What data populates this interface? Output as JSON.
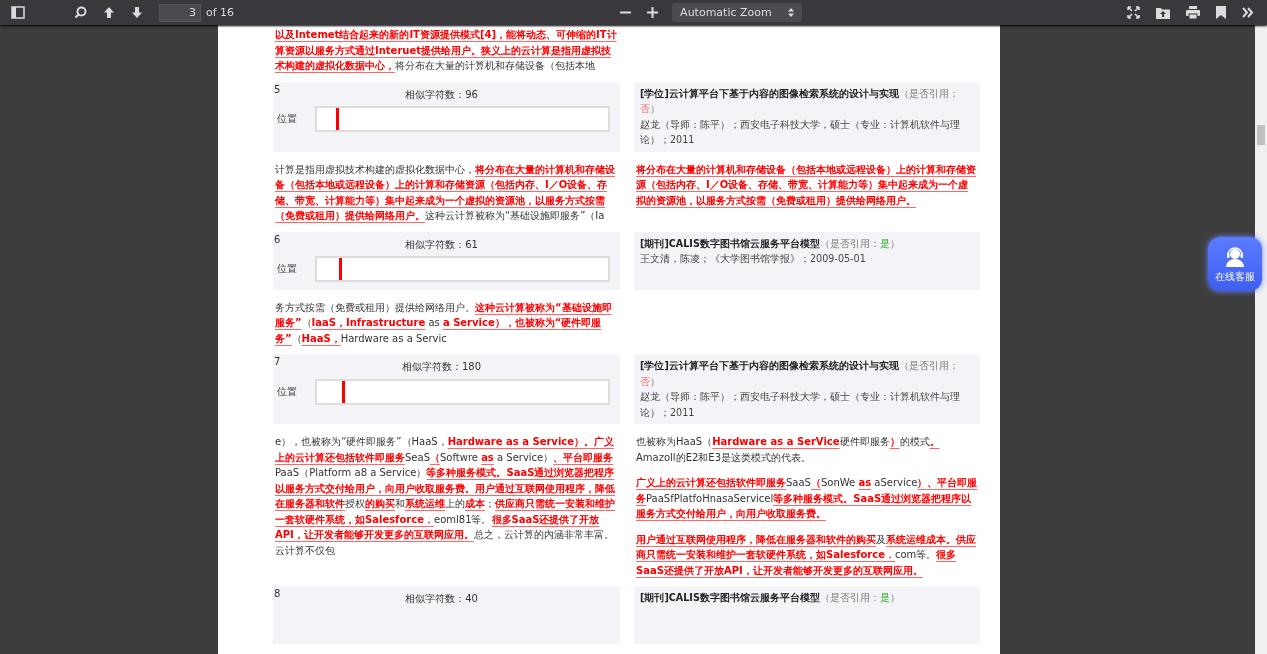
{
  "toolbar": {
    "page": "3",
    "page_count": "of 16",
    "zoom": "Automatic Zoom"
  },
  "document": {
    "blocks": [
      {
        "kind": "text",
        "left": [
          [
            {
              "text": "以及Intemet结合起来的新的IT资源提供模式[4]，能将动态、可伸缩的IT计算资源以服务方式通过Interuet提供给用户。狭义上的云计算是指用虚拟技术构建的虚拟化数据中心，",
              "hit": true
            },
            {
              "text": "将分布在大量的计算机和存储设备（包括本地",
              "hit": false
            }
          ]
        ]
      },
      {
        "kind": "match",
        "number": "5",
        "similar": "相似字符数：96",
        "position_label": "位置",
        "level": 0.065,
        "source": {
          "title": "[学位]云计算平台下基于内容的图像检索系统的设计与实现",
          "cite_prefix": "（是否引用：",
          "cite_value": "否",
          "cite_suffix": "）",
          "cited": false,
          "details": "赵龙（导师：陈平）；西安电子科技大学，硕士（专业：计算机软件与理论）；2011"
        }
      },
      {
        "kind": "text",
        "left": [
          [
            {
              "text": "计算是指用虚拟技术构建的虚拟化数据中心，",
              "hit": false
            },
            {
              "text": "将分布在大量的计算机和存储设备（包括本地或远程设备）上的计算和存储资源（包括内存、I／O设备、存储、带宽、计算能力等）集中起来成为一个虚拟的资源池，以服务方式按需（免费或租用）提供给网络用户。",
              "hit": true
            },
            {
              "text": "这种云计算被称为“基础设施即服务”（Ia",
              "hit": false
            }
          ]
        ],
        "right": [
          [
            {
              "text": "将分布在大量的计算机和存储设备（包括本地或远程设备）上的计算和存储资源（包括内存、I／O设备、存储、带宽、计算能力等）集中起来成为一个虚拟的资源池，以服务方式按需（免费或租用）提供给网络用户。",
              "hit": true
            }
          ]
        ]
      },
      {
        "kind": "match",
        "number": "6",
        "similar": "相似字符数：61",
        "position_label": "位置",
        "level": 0.075,
        "source": {
          "title": "[期刊]CALIS数字图书馆云服务平台模型",
          "cite_prefix": "（是否引用：",
          "cite_value": "是",
          "cite_suffix": "）",
          "cited": true,
          "details": "王文清，陈凌；《大学图书馆学报》；2009-05-01"
        }
      },
      {
        "kind": "text",
        "left": [
          [
            {
              "text": "务方式按需（免费或租用）提供给网络用户。",
              "hit": false
            },
            {
              "text": "这种云计算被称为“基础设施即服务”",
              "hit": true
            },
            {
              "text": "（",
              "hit": false
            },
            {
              "text": "IaaS，Infrastructure",
              "hit": true
            },
            {
              "text": " as ",
              "hit": false
            },
            {
              "text": "a Service），也被称为“硬件即服务”",
              "hit": true
            },
            {
              "text": "（",
              "hit": false
            },
            {
              "text": "HaaS，",
              "hit": true
            },
            {
              "text": "Hardware as a Servic",
              "hit": false
            }
          ]
        ]
      },
      {
        "kind": "match",
        "number": "7",
        "similar": "相似字符数：180",
        "position_label": "位置",
        "level": 0.085,
        "source": {
          "title": "[学位]云计算平台下基于内容的图像检索系统的设计与实现",
          "cite_prefix": "（是否引用：",
          "cite_value": "否",
          "cite_suffix": "）",
          "cited": false,
          "details": "赵龙（导师：陈平）；西安电子科技大学，硕士（专业：计算机软件与理论）；2011"
        }
      },
      {
        "kind": "text",
        "left": [
          [
            {
              "text": "e），也被称为“硬件即服务”（HaaS，",
              "hit": false
            },
            {
              "text": "Hardware as a Service）。广义上的云计算还包括软件即服务",
              "hit": true
            },
            {
              "text": "SeaS",
              "hit": false
            },
            {
              "text": "（",
              "hit": true
            },
            {
              "text": "Softwre ",
              "hit": false
            },
            {
              "text": "as",
              "hit": true
            },
            {
              "text": " a Service）",
              "hit": false
            },
            {
              "text": "、平台即服务",
              "hit": true
            },
            {
              "text": "PaaS（Platform a8 a Service）",
              "hit": false
            },
            {
              "text": "等多种服务模式。SaaS通过浏览器把程序以服务方式交付给用户，向用户收取服务费。用户通过互联网使用程序，降低在服务器和软件",
              "hit": true
            },
            {
              "text": "授权",
              "hit": false
            },
            {
              "text": "的购买",
              "hit": true
            },
            {
              "text": "和",
              "hit": false
            },
            {
              "text": "系统运维",
              "hit": true
            },
            {
              "text": "上的",
              "hit": false
            },
            {
              "text": "成本",
              "hit": true
            },
            {
              "text": "；",
              "hit": false
            },
            {
              "text": "供应商只需统一安装和维护一套软硬件系统，如Salesforce．",
              "hit": true
            },
            {
              "text": "eoml81等。",
              "hit": false
            },
            {
              "text": "很多SaaS还提供了开放API，让开发者能够开发更多的互联网应用。",
              "hit": true
            },
            {
              "text": "总之，云计算的内涵非常丰富。云计算不仅包",
              "hit": false
            }
          ]
        ],
        "right": [
          [
            {
              "text": "也被称为HaaS（",
              "hit": false
            },
            {
              "text": "Hardware as a SerVice",
              "hit": true
            },
            {
              "text": "硬件即服务",
              "hit": false
            },
            {
              "text": "）",
              "hit": true
            },
            {
              "text": "的模式",
              "hit": false
            },
            {
              "text": "。",
              "hit": true
            },
            {
              "text": "Amazoll的E2和E3是这类模式的代表。",
              "hit": false
            }
          ],
          [
            {
              "text": "广义上的云计算还包括软件即服务",
              "hit": true
            },
            {
              "text": "SaaS",
              "hit": false
            },
            {
              "text": "（",
              "hit": true
            },
            {
              "text": "SonWe ",
              "hit": false
            },
            {
              "text": "as",
              "hit": true
            },
            {
              "text": " aService",
              "hit": false
            },
            {
              "text": "）、平台即服务",
              "hit": true
            },
            {
              "text": "PaaSfPlatfoHnasaServicel",
              "hit": false
            },
            {
              "text": "等多种服务模式。SaaS通过浏览器把程序以服务方式交付给用户，向用户收取服务费。",
              "hit": true
            }
          ],
          [
            {
              "text": "用户通过互联网使用程序，降低在服务器和软件的购买",
              "hit": true
            },
            {
              "text": "及",
              "hit": false
            },
            {
              "text": "系统运维成本。供应商只需统一安装和维护一套软硬件系统，如Salesforce．",
              "hit": true
            },
            {
              "text": "com等。",
              "hit": false
            },
            {
              "text": "很多SaaS还提供了开放API，让开发者能够开发更多的互联网应用。",
              "hit": true
            }
          ]
        ]
      },
      {
        "kind": "match",
        "number": "8",
        "similar": "相似字符数：40",
        "source": {
          "title": "[期刊]CALIS数字图书馆云服务平台模型",
          "cite_prefix": "（是否引用：",
          "cite_value": "是",
          "cite_suffix": "）",
          "cited": true
        }
      }
    ]
  },
  "chat_button": {
    "label": "在线客服"
  }
}
